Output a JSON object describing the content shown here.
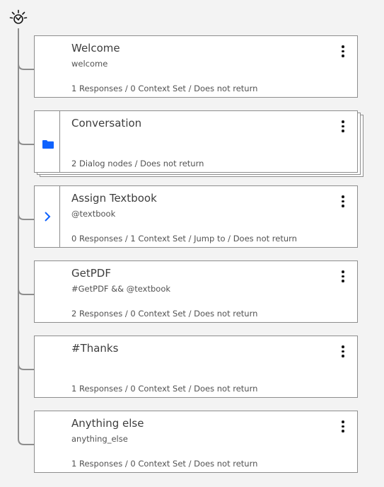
{
  "tree": {
    "root_icon": "ibm-watson-icon",
    "nodes": [
      {
        "title": "Welcome",
        "condition": "welcome",
        "meta": "1 Responses / 0 Context Set / Does not return"
      },
      {
        "title": "Conversation",
        "condition": "",
        "meta": "2 Dialog nodes / Does not return",
        "icon": "folder-icon"
      },
      {
        "title": "Assign Textbook",
        "condition": "@textbook",
        "meta": "0 Responses / 1 Context Set / Jump to / Does not return",
        "icon": "chevron-right-icon"
      },
      {
        "title": "GetPDF",
        "condition": "#GetPDF && @textbook",
        "meta": "2 Responses / 0 Context Set / Does not return"
      },
      {
        "title": "#Thanks",
        "condition": "",
        "meta": "1 Responses / 0 Context Set / Does not return"
      },
      {
        "title": "Anything else",
        "condition": "anything_else",
        "meta": "1 Responses / 0 Context Set / Does not return"
      }
    ]
  },
  "colors": {
    "accent": "#0f62fe",
    "border": "#8d8d8d",
    "connector": "#8d8d8d"
  }
}
